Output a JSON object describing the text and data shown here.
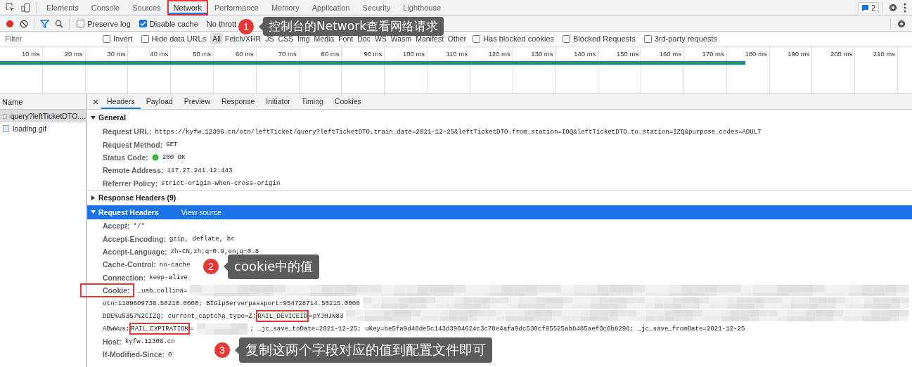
{
  "main_tabs": [
    {
      "label": "Elements",
      "selected": false,
      "highlighted": false
    },
    {
      "label": "Console",
      "selected": false,
      "highlighted": false
    },
    {
      "label": "Sources",
      "selected": false,
      "highlighted": false
    },
    {
      "label": "Network",
      "selected": true,
      "highlighted": true
    },
    {
      "label": "Performance",
      "selected": false,
      "highlighted": false
    },
    {
      "label": "Memory",
      "selected": false,
      "highlighted": false
    },
    {
      "label": "Application",
      "selected": false,
      "highlighted": false
    },
    {
      "label": "Security",
      "selected": false,
      "highlighted": false
    },
    {
      "label": "Lighthouse",
      "selected": false,
      "highlighted": false
    }
  ],
  "issues_badge": "2",
  "toolbar": {
    "recording": true,
    "filter_active": true,
    "checkboxes": [
      {
        "label": "Preserve log",
        "checked": false
      },
      {
        "label": "Disable cache",
        "checked": true
      }
    ],
    "throttling": "No thrott"
  },
  "filter_bar": {
    "placeholder": "Filter",
    "checkboxes": [
      {
        "label": "Invert",
        "checked": false
      },
      {
        "label": "Hide data URLs",
        "checked": false
      }
    ],
    "types": [
      {
        "label": "All",
        "selected": true
      },
      {
        "label": "Fetch/XHR",
        "selected": false
      },
      {
        "label": "JS",
        "selected": false
      },
      {
        "label": "CSS",
        "selected": false
      },
      {
        "label": "Img",
        "selected": false
      },
      {
        "label": "Media",
        "selected": false
      },
      {
        "label": "Font",
        "selected": false
      },
      {
        "label": "Doc",
        "selected": false
      },
      {
        "label": "WS",
        "selected": false
      },
      {
        "label": "Wasm",
        "selected": false
      },
      {
        "label": "Manifest",
        "selected": false
      },
      {
        "label": "Other",
        "selected": false
      }
    ],
    "extra_checkboxes": [
      {
        "label": "Has blocked cookies",
        "checked": false
      },
      {
        "label": "Blocked Requests",
        "checked": false
      },
      {
        "label": "3rd-party requests",
        "checked": false
      }
    ]
  },
  "timeline": {
    "ticks": [
      "10 ms",
      "20 ms",
      "30 ms",
      "40 ms",
      "50 ms",
      "60 ms",
      "70 ms",
      "80 ms",
      "90 ms",
      "100 ms",
      "110 ms",
      "120 ms",
      "130 ms",
      "140 ms",
      "150 ms",
      "160 ms",
      "170 ms",
      "180 ms",
      "190 ms",
      "200 ms",
      "210 ms"
    ],
    "level": 0.83
  },
  "requests": {
    "column": "Name",
    "items": [
      {
        "name": "query?leftTicketDTO....",
        "kind": "doc",
        "selected": true
      },
      {
        "name": "loading.gif",
        "kind": "image",
        "selected": false
      }
    ]
  },
  "detail_tabs": [
    {
      "label": "Headers",
      "selected": true
    },
    {
      "label": "Payload",
      "selected": false
    },
    {
      "label": "Preview",
      "selected": false
    },
    {
      "label": "Response",
      "selected": false
    },
    {
      "label": "Initiator",
      "selected": false
    },
    {
      "label": "Timing",
      "selected": false
    },
    {
      "label": "Cookies",
      "selected": false
    }
  ],
  "sections": [
    {
      "title": "General",
      "expanded": true,
      "highlighted": false,
      "rows": [
        {
          "key": "Request URL:",
          "value": "https://kyfw.12306.cn/otn/leftTicket/query?leftTicketDTO.train_date=2021-12-25&leftTicketDTO.from_station=IOQ&leftTicketDTO.to_station=IZQ&purpose_codes=ADULT"
        },
        {
          "key": "Request Method:",
          "value": "GET"
        },
        {
          "key": "Status Code:",
          "value": "200 OK",
          "status_ok": true
        },
        {
          "key": "Remote Address:",
          "value": "117.27.241.12:443"
        },
        {
          "key": "Referrer Policy:",
          "value": "strict-origin-when-cross-origin"
        }
      ]
    },
    {
      "title": "Response Headers (9)",
      "expanded": false,
      "highlighted": false
    },
    {
      "title": "Request Headers",
      "expanded": true,
      "highlighted": true,
      "link": "View source",
      "rows": [
        {
          "key": "Accept:",
          "value": "*/*"
        },
        {
          "key": "Accept-Encoding:",
          "value": "gzip, deflate, br"
        },
        {
          "key": "Accept-Language:",
          "value": "zh-CN,zh;q=0.9,en;q=0.8"
        },
        {
          "key": "Cache-Control:",
          "value": "no-cache"
        },
        {
          "key": "Connection:",
          "value": "keep-alive"
        },
        {
          "key": "Cookie:",
          "key_highlighted": true,
          "lines": [
            [
              {
                "kind": "plain",
                "text": "_uab_collina="
              },
              {
                "kind": "redacted"
              }
            ],
            [
              {
                "kind": "plain",
                "text": "otn=1189609738.50210.0000; BIGipServerpassport=954728714.50215.0000"
              },
              {
                "kind": "redacted"
              }
            ],
            [
              {
                "kind": "plain",
                "text": "DDE%u5357%2CIZQ; current_captcha_type=Z; "
              },
              {
                "kind": "key",
                "text": "RAIL_DEVICEID"
              },
              {
                "kind": "plain",
                "text": "=pYJHJN83"
              },
              {
                "kind": "redacted"
              }
            ],
            [
              {
                "kind": "plain",
                "text": "ABwWus; "
              },
              {
                "kind": "key",
                "text": "RAIL_EXPIRATION"
              },
              {
                "kind": "plain",
                "text": "="
              },
              {
                "kind": "redacted",
                "short": true
              },
              {
                "kind": "plain",
                "text": "; _jc_save_toDate=2021-12-25; uKey=be5fa9d48de5c143d3904624c3c78e4afa9dc530cf95525ab8485aef3c6b8298; _jc_save_fromDate=2021-12-25"
              }
            ]
          ]
        },
        {
          "key": "Host:",
          "value": "kyfw.12306.cn"
        },
        {
          "key": "If-Modified-Since:",
          "value": "0"
        }
      ]
    }
  ],
  "annotations": [
    {
      "number": "1",
      "text": "控制台的Network查看网络请求"
    },
    {
      "number": "2",
      "text": "cookie中的值"
    },
    {
      "number": "3",
      "text": "复制这两个字段对应的值到配置文件即可"
    }
  ]
}
